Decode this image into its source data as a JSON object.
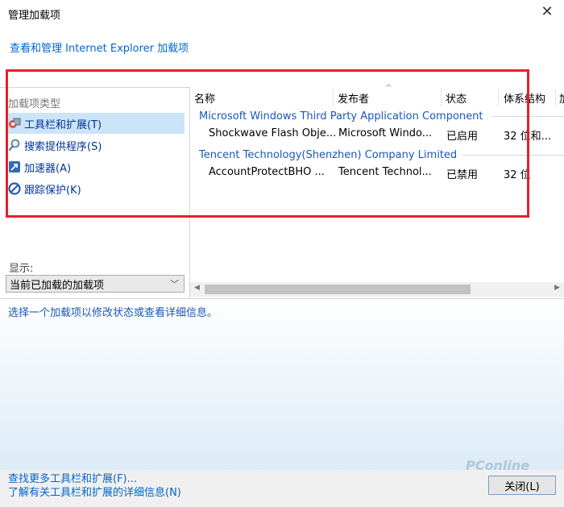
{
  "window": {
    "title": "管理加载项"
  },
  "header": {
    "manage_link": "查看和管理 Internet Explorer 加载项"
  },
  "left": {
    "group_heading": "加载项类型",
    "categories": [
      {
        "label": "工具栏和扩展(T)",
        "icon": "toolbar-extension-icon",
        "selected": true
      },
      {
        "label": "搜索提供程序(S)",
        "icon": "search-icon",
        "selected": false
      },
      {
        "label": "加速器(A)",
        "icon": "accelerator-icon",
        "selected": false
      },
      {
        "label": "跟踪保护(K)",
        "icon": "tracking-protection-icon",
        "selected": false
      }
    ],
    "show_label": "显示:",
    "show_value": "当前已加载的加载项"
  },
  "table": {
    "columns": [
      "名称",
      "发布者",
      "状态",
      "体系结构",
      "加"
    ],
    "groups": [
      {
        "name": "Microsoft Windows Third Party Application Component",
        "rows": [
          {
            "name": "Shockwave Flash Obje...",
            "publisher": "Microsoft Windo...",
            "status": "已启用",
            "arch": "32 位和..."
          }
        ]
      },
      {
        "name": "Tencent Technology(Shenzhen) Company Limited",
        "rows": [
          {
            "name": "AccountProtectBHO ...",
            "publisher": "Tencent Technol...",
            "status": "已禁用",
            "arch": "32 位"
          }
        ]
      }
    ]
  },
  "details": {
    "hint": "选择一个加载项以修改状态或查看详细信息。"
  },
  "footer": {
    "link_more": "查找更多工具栏和扩展(F)...",
    "link_learn": "了解有关工具栏和扩展的详细信息(N)",
    "close_button": "关闭(L)"
  },
  "watermark": "PConline",
  "colors": {
    "link": "#0066cc",
    "group_text": "#1a56b8",
    "selection": "#cce4f7",
    "highlight_box": "#e5202b"
  }
}
